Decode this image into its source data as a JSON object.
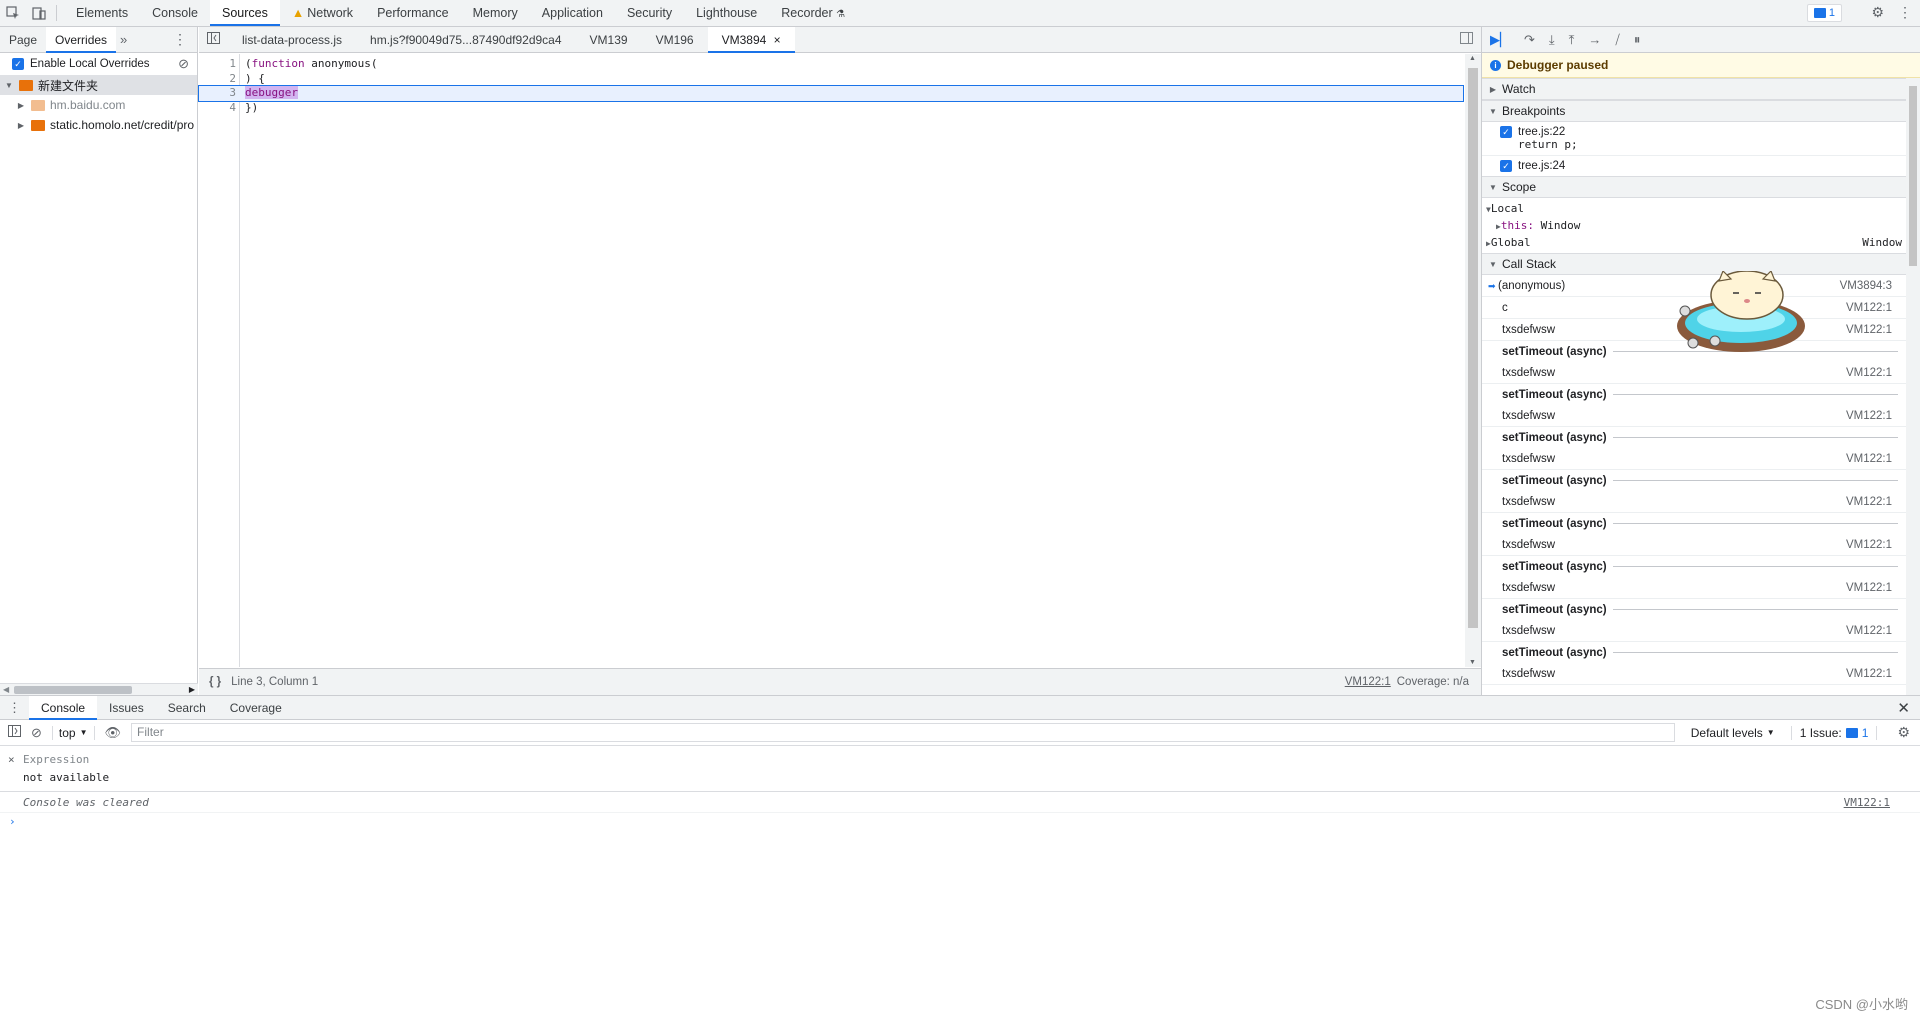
{
  "topbar": {
    "tabs": [
      "Elements",
      "Console",
      "Sources",
      "Network",
      "Performance",
      "Memory",
      "Application",
      "Security",
      "Lighthouse",
      "Recorder"
    ],
    "active_tab": "Sources",
    "issues_count": "1"
  },
  "navigator": {
    "tabs": [
      "Page",
      "Overrides"
    ],
    "active_tab": "Overrides",
    "enable_overrides_label": "Enable Local Overrides",
    "tree": {
      "root": "新建文件夹",
      "children": [
        "hm.baidu.com",
        "static.homolo.net/credit/pro"
      ]
    }
  },
  "editor": {
    "tabs": [
      "list-data-process.js",
      "hm.js?f90049d75...87490df92d9ca4",
      "VM139",
      "VM196",
      "VM3894"
    ],
    "active_tab": "VM3894",
    "lines": [
      {
        "num": "1",
        "pre": "(",
        "kw": "function",
        "post": " anonymous("
      },
      {
        "num": "2",
        "text": ") {"
      },
      {
        "num": "3",
        "hl": "debugger"
      },
      {
        "num": "4",
        "text": "})"
      }
    ],
    "status": {
      "position": "Line 3, Column 1",
      "source_link": "VM122:1",
      "coverage": "Coverage: n/a"
    }
  },
  "debugger": {
    "paused_text": "Debugger paused",
    "sections": {
      "watch": "Watch",
      "breakpoints": "Breakpoints",
      "scope": "Scope",
      "call_stack": "Call Stack"
    },
    "breakpoints": [
      {
        "label": "tree.js:22",
        "code": "return p;"
      },
      {
        "label": "tree.js:24",
        "code": ""
      }
    ],
    "scope": {
      "local": "Local",
      "this_key": "this:",
      "this_val": "Window",
      "global": "Global",
      "global_val": "Window"
    },
    "call_stack": [
      {
        "name": "(anonymous)",
        "loc": "VM3894:3",
        "current": true
      },
      {
        "name": "c",
        "loc": "VM122:1"
      },
      {
        "name": "txsdefwsw",
        "loc": "VM122:1"
      },
      {
        "async": "setTimeout (async)"
      },
      {
        "name": "txsdefwsw",
        "loc": "VM122:1"
      },
      {
        "async": "setTimeout (async)"
      },
      {
        "name": "txsdefwsw",
        "loc": "VM122:1"
      },
      {
        "async": "setTimeout (async)"
      },
      {
        "name": "txsdefwsw",
        "loc": "VM122:1"
      },
      {
        "async": "setTimeout (async)"
      },
      {
        "name": "txsdefwsw",
        "loc": "VM122:1"
      },
      {
        "async": "setTimeout (async)"
      },
      {
        "name": "txsdefwsw",
        "loc": "VM122:1"
      },
      {
        "async": "setTimeout (async)"
      },
      {
        "name": "txsdefwsw",
        "loc": "VM122:1"
      },
      {
        "async": "setTimeout (async)"
      },
      {
        "name": "txsdefwsw",
        "loc": "VM122:1"
      },
      {
        "async": "setTimeout (async)"
      },
      {
        "name": "txsdefwsw",
        "loc": "VM122:1"
      }
    ]
  },
  "drawer": {
    "tabs": [
      "Console",
      "Issues",
      "Search",
      "Coverage"
    ],
    "active_tab": "Console",
    "context": "top",
    "filter_placeholder": "Filter",
    "levels": "Default levels",
    "issues_label": "1 Issue:",
    "issues_count": "1",
    "expression_label": "Expression",
    "expression_value": "not available",
    "cleared_msg": "Console was cleared",
    "cleared_link": "VM122:1"
  },
  "watermark": "CSDN @小水哟"
}
